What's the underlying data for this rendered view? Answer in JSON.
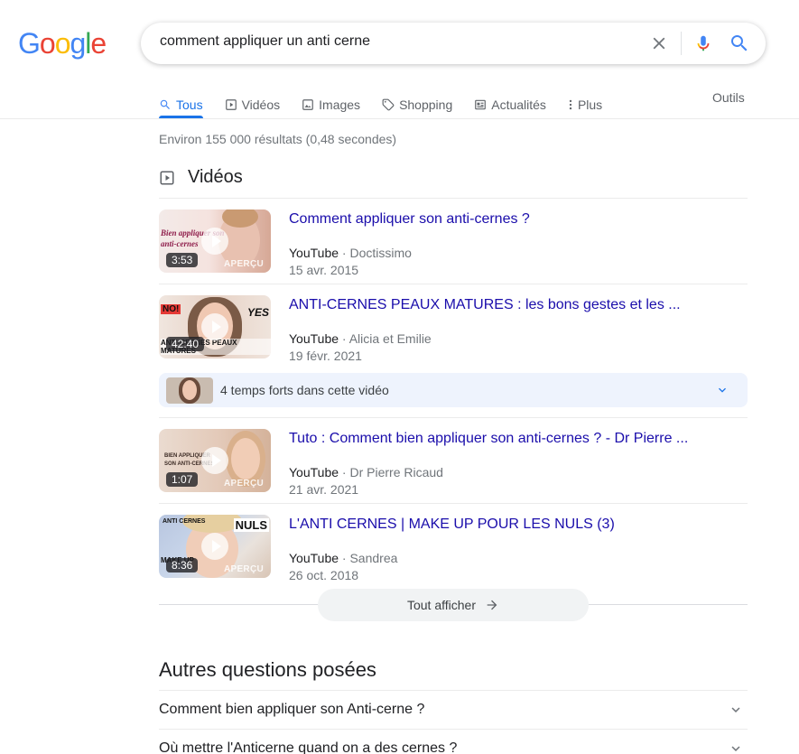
{
  "logo": {
    "letters": [
      "G",
      "o",
      "o",
      "g",
      "l",
      "e"
    ],
    "colors": [
      "#4285f4",
      "#ea4335",
      "#fbbc05",
      "#4285f4",
      "#34a853",
      "#ea4335"
    ]
  },
  "search": {
    "query": "comment appliquer un anti cerne"
  },
  "tabs": [
    {
      "label": "Tous",
      "icon": "search-icon",
      "active": true
    },
    {
      "label": "Vidéos",
      "icon": "video-icon"
    },
    {
      "label": "Images",
      "icon": "image-icon"
    },
    {
      "label": "Shopping",
      "icon": "tag-icon"
    },
    {
      "label": "Actualités",
      "icon": "news-icon"
    },
    {
      "label": "Plus",
      "icon": "more-dots-icon"
    }
  ],
  "tools_label": "Outils",
  "result_stats": "Environ 155 000 résultats (0,48 secondes)",
  "videos_section": {
    "title": "Vidéos",
    "items": [
      {
        "title": "Comment appliquer son anti-cernes ?",
        "source": "YouTube",
        "channel": "Doctissimo",
        "date": "15 avr. 2015",
        "duration": "3:53",
        "preview": "APERÇU"
      },
      {
        "title": "ANTI-CERNES PEAUX MATURES : les bons gestes et les ...",
        "source": "YouTube",
        "channel": "Alicia et Emilie",
        "date": "19 févr. 2021",
        "duration": "42:40",
        "preview": ""
      },
      {
        "title": "Tuto : Comment bien appliquer son anti-cernes ? - Dr Pierre ...",
        "source": "YouTube",
        "channel": "Dr Pierre Ricaud",
        "date": "21 avr. 2021",
        "duration": "1:07",
        "preview": "APERÇU"
      },
      {
        "title": "L'ANTI CERNES | MAKE UP POUR LES NULS (3)",
        "source": "YouTube",
        "channel": "Sandrea",
        "date": "26 oct. 2018",
        "duration": "8:36",
        "preview": "APERÇU"
      }
    ],
    "key_moments": "4 temps forts dans cette vidéo",
    "show_all": "Tout afficher",
    "thumb_texts": {
      "t1": "Bien appliquer son anti-cernes",
      "t2_no": "NO!",
      "t2_yes": "YES",
      "t2_bottom": "ANTI-CERNES PEAUX MATURES",
      "t3": "BIEN APPLIQUER SON ANTI-CERNES",
      "t4_top": "ANTI CERNES",
      "t4_nuls": "NULS",
      "t4_make": "MAKE UP"
    }
  },
  "paa": {
    "title": "Autres questions posées",
    "questions": [
      "Comment bien appliquer son Anti-cerne ?",
      "Où mettre l'Anticerne quand on a des cernes ?"
    ]
  }
}
